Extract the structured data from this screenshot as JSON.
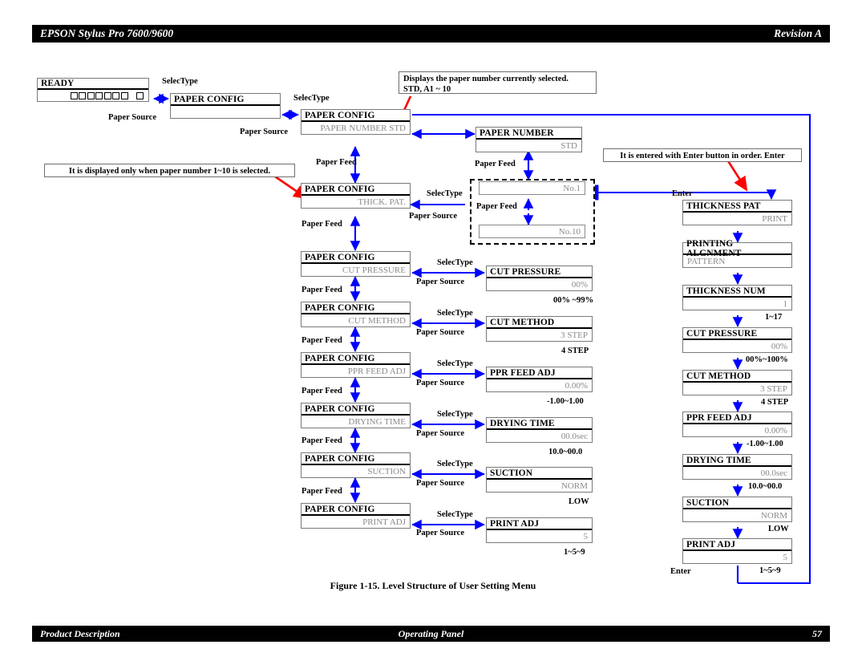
{
  "header": {
    "title": "EPSON Stylus Pro 7600/9600",
    "revision": "Revision A"
  },
  "footer": {
    "left": "Product Description",
    "center": "Operating Panel",
    "page": "57"
  },
  "figure": {
    "caption": "Figure 1-15.  Level Structure of User Setting Menu"
  },
  "notes": {
    "paper_number": "Displays the paper number currently selected.\nSTD, A1 ~ 10",
    "paper_number_line1": "Displays the paper number currently selected.",
    "paper_number_line2": "STD, A1 ~ 10",
    "only_when": "It is displayed only when paper number 1~10 is selected.",
    "enter_order": "It is entered with Enter button in order. Enter"
  },
  "buttons": {
    "selectype": "SelecType",
    "paper_source": "Paper Source",
    "paper_feed": "Paper Feed",
    "enter": "Enter"
  },
  "ready_panel": {
    "title": "READY",
    "ink_squares": 7,
    "extra_square": 1
  },
  "column1": {
    "boxes": [
      {
        "title": "PAPER CONFIG",
        "value": ""
      }
    ]
  },
  "column2": {
    "boxes": [
      {
        "title": "PAPER CONFIG",
        "value": "PAPER NUMBER STD"
      },
      {
        "title": "PAPER CONFIG",
        "value": "THICK. PAT."
      },
      {
        "title": "PAPER CONFIG",
        "value": "CUT PRESSURE"
      },
      {
        "title": "PAPER CONFIG",
        "value": "CUT METHOD"
      },
      {
        "title": "PAPER CONFIG",
        "value": "PPR FEED ADJ"
      },
      {
        "title": "PAPER CONFIG",
        "value": "DRYING TIME"
      },
      {
        "title": "PAPER CONFIG",
        "value": "SUCTION"
      },
      {
        "title": "PAPER CONFIG",
        "value": "PRINT ADJ"
      }
    ]
  },
  "column3": {
    "paper_number": {
      "title": "PAPER NUMBER",
      "value": "STD"
    },
    "number_group": [
      {
        "value": "No.1"
      },
      {
        "value": "No.10"
      }
    ],
    "boxes": [
      {
        "title": "CUT PRESSURE",
        "value": "00%",
        "range": "00% ~99%"
      },
      {
        "title": "CUT METHOD",
        "value": "3 STEP",
        "range": "4 STEP"
      },
      {
        "title": "PPR FEED ADJ",
        "value": "0.00%",
        "range": "-1.00~1.00"
      },
      {
        "title": "DRYING TIME",
        "value": "00.0sec",
        "range": "10.0~00.0"
      },
      {
        "title": "SUCTION",
        "value": "NORM",
        "range": "LOW"
      },
      {
        "title": "PRINT ADJ",
        "value": "5",
        "range": "1~5~9"
      }
    ]
  },
  "column4": {
    "boxes": [
      {
        "title": "THICKNESS PAT",
        "value": "PRINT",
        "align": "right",
        "range": ""
      },
      {
        "title": "PRINTING ALGNMENT",
        "value": "PATTERN",
        "align": "left",
        "range": ""
      },
      {
        "title": "THICKNESS NUM",
        "value": "1",
        "align": "right",
        "range": "1~17"
      },
      {
        "title": "CUT PRESSURE",
        "value": "00%",
        "align": "right",
        "range": "00%~100%"
      },
      {
        "title": "CUT METHOD",
        "value": "3 STEP",
        "align": "right",
        "range": "4 STEP"
      },
      {
        "title": "PPR FEED ADJ",
        "value": "0.00%",
        "align": "right",
        "range": "-1.00~1.00"
      },
      {
        "title": "DRYING TIME",
        "value": "00.0sec",
        "align": "right",
        "range": "10.0~00.0"
      },
      {
        "title": "SUCTION",
        "value": "NORM",
        "align": "right",
        "range": "LOW"
      },
      {
        "title": "PRINT ADJ",
        "value": "5",
        "align": "right",
        "range": "1~5~9"
      }
    ]
  },
  "colors": {
    "arrow_blue": "#0000FF",
    "callout_red": "#FF0000",
    "lcd_value_gray": "#8a8a8a",
    "bar_black": "#000000"
  }
}
